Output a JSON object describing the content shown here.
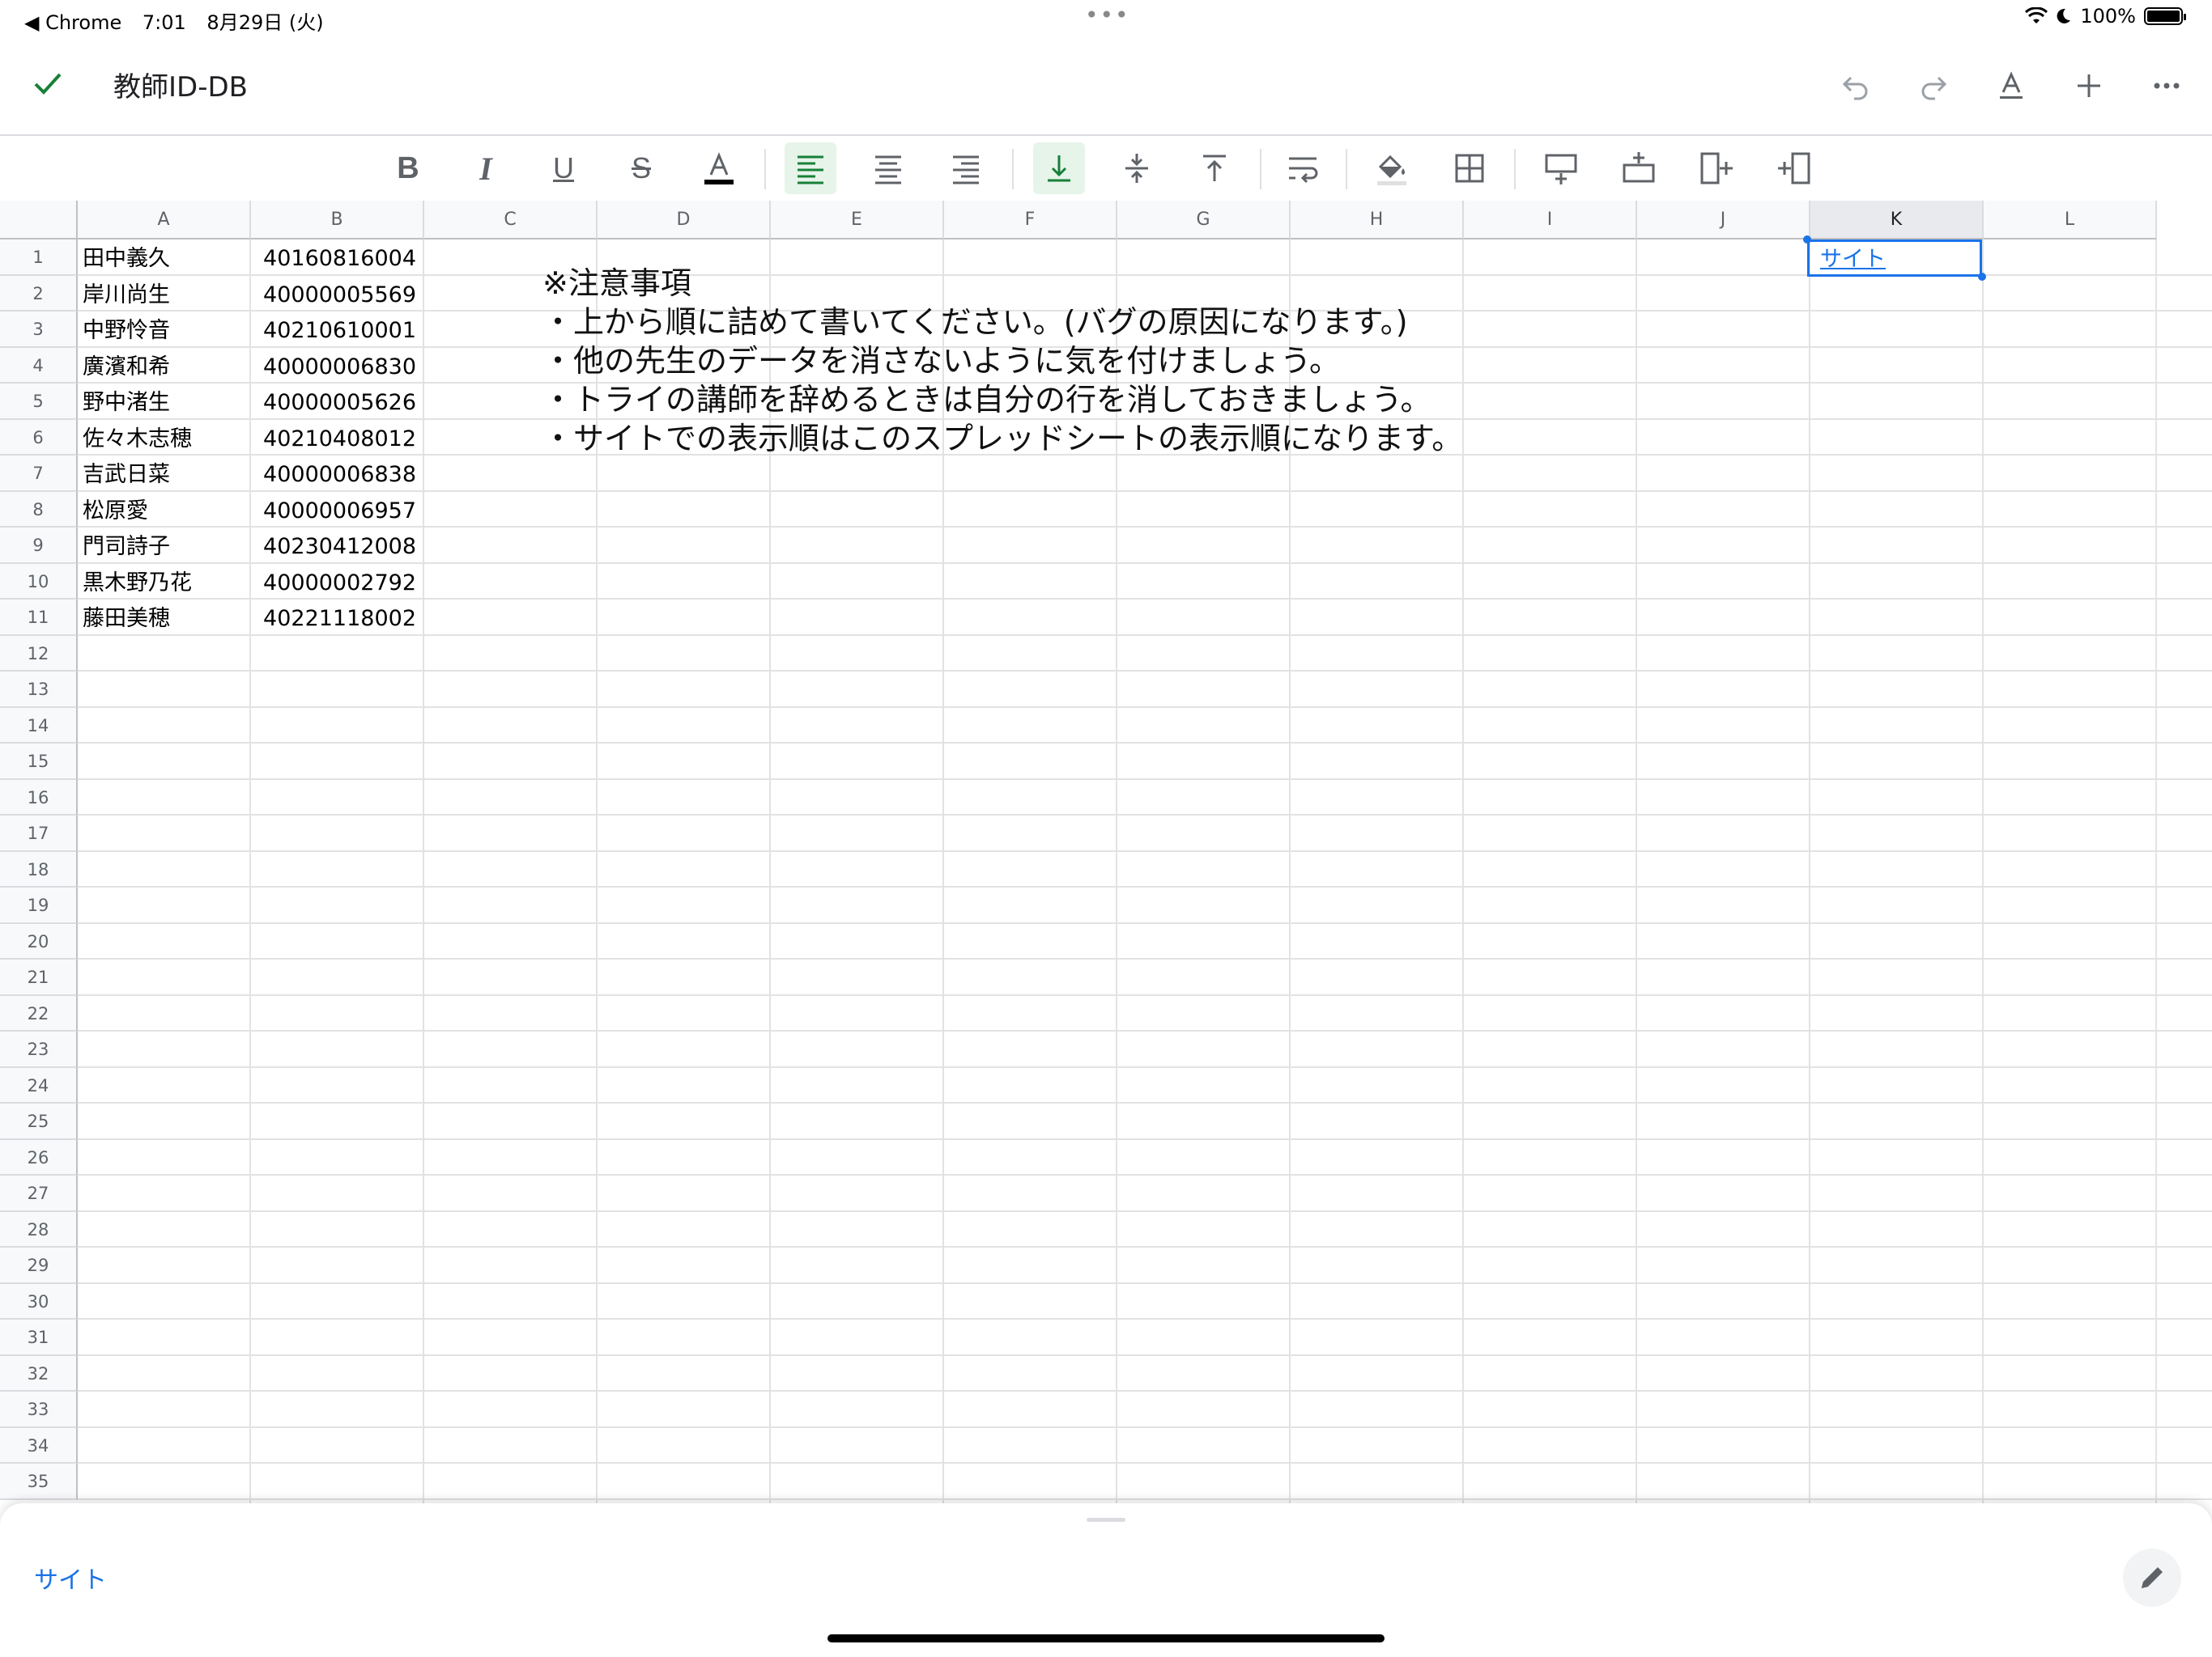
{
  "status_bar": {
    "back_app": "◀ Chrome",
    "time": "7:01",
    "date": "8月29日 (火)",
    "battery": "100%"
  },
  "title_bar": {
    "doc_title": "教師ID-DB"
  },
  "columns": [
    "A",
    "B",
    "C",
    "D",
    "E",
    "F",
    "G",
    "H",
    "I",
    "J",
    "K",
    "L"
  ],
  "selected_column": "K",
  "row_count": 35,
  "rows": [
    {
      "name": "田中義久",
      "id": "40160816004"
    },
    {
      "name": "岸川尚生",
      "id": "40000005569"
    },
    {
      "name": "中野怜音",
      "id": "40210610001"
    },
    {
      "name": "廣濱和希",
      "id": "40000006830"
    },
    {
      "name": "野中渚生",
      "id": "40000005626"
    },
    {
      "name": "佐々木志穂",
      "id": "40210408012"
    },
    {
      "name": "吉武日菜",
      "id": "40000006838"
    },
    {
      "name": "松原愛",
      "id": "40000006957"
    },
    {
      "name": "門司詩子",
      "id": "40230412008"
    },
    {
      "name": "黒木野乃花",
      "id": "40000002792"
    },
    {
      "name": "藤田美穂",
      "id": "40221118002"
    }
  ],
  "notes": [
    "※注意事項",
    "・上から順に詰めて書いてください。(バグの原因になります。)",
    "・他の先生のデータを消さないように気を付けましょう。",
    "・トライの講師を辞めるときは自分の行を消しておきましょう。",
    "・サイトでの表示順はこのスプレッドシートの表示順になります。"
  ],
  "k1_link": "サイト",
  "bottom_panel": {
    "link_text": "サイト"
  },
  "colors": {
    "accent_green": "#188038",
    "link_blue": "#1a73e8"
  }
}
